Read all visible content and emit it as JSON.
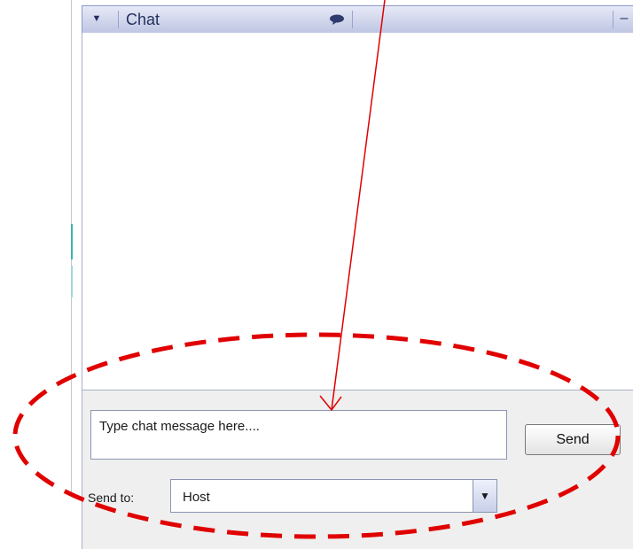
{
  "panel": {
    "title": "Chat",
    "collapse_icon": "triangle-down-icon",
    "status_icon": "speech-bubble-icon",
    "minimize_icon": "minus-icon"
  },
  "composer": {
    "message_placeholder": "Type chat message here....",
    "send_label": "Send",
    "send_to_label": "Send to:",
    "recipient_value": "Host",
    "dropdown_icon": "triangle-down-icon"
  },
  "annotation": {
    "arrow_color": "#e00000",
    "ellipse_color": "#e00000"
  },
  "colors": {
    "titlebar": "#c9cfea",
    "title_text": "#23305e",
    "bottom_panel": "#efefef"
  }
}
